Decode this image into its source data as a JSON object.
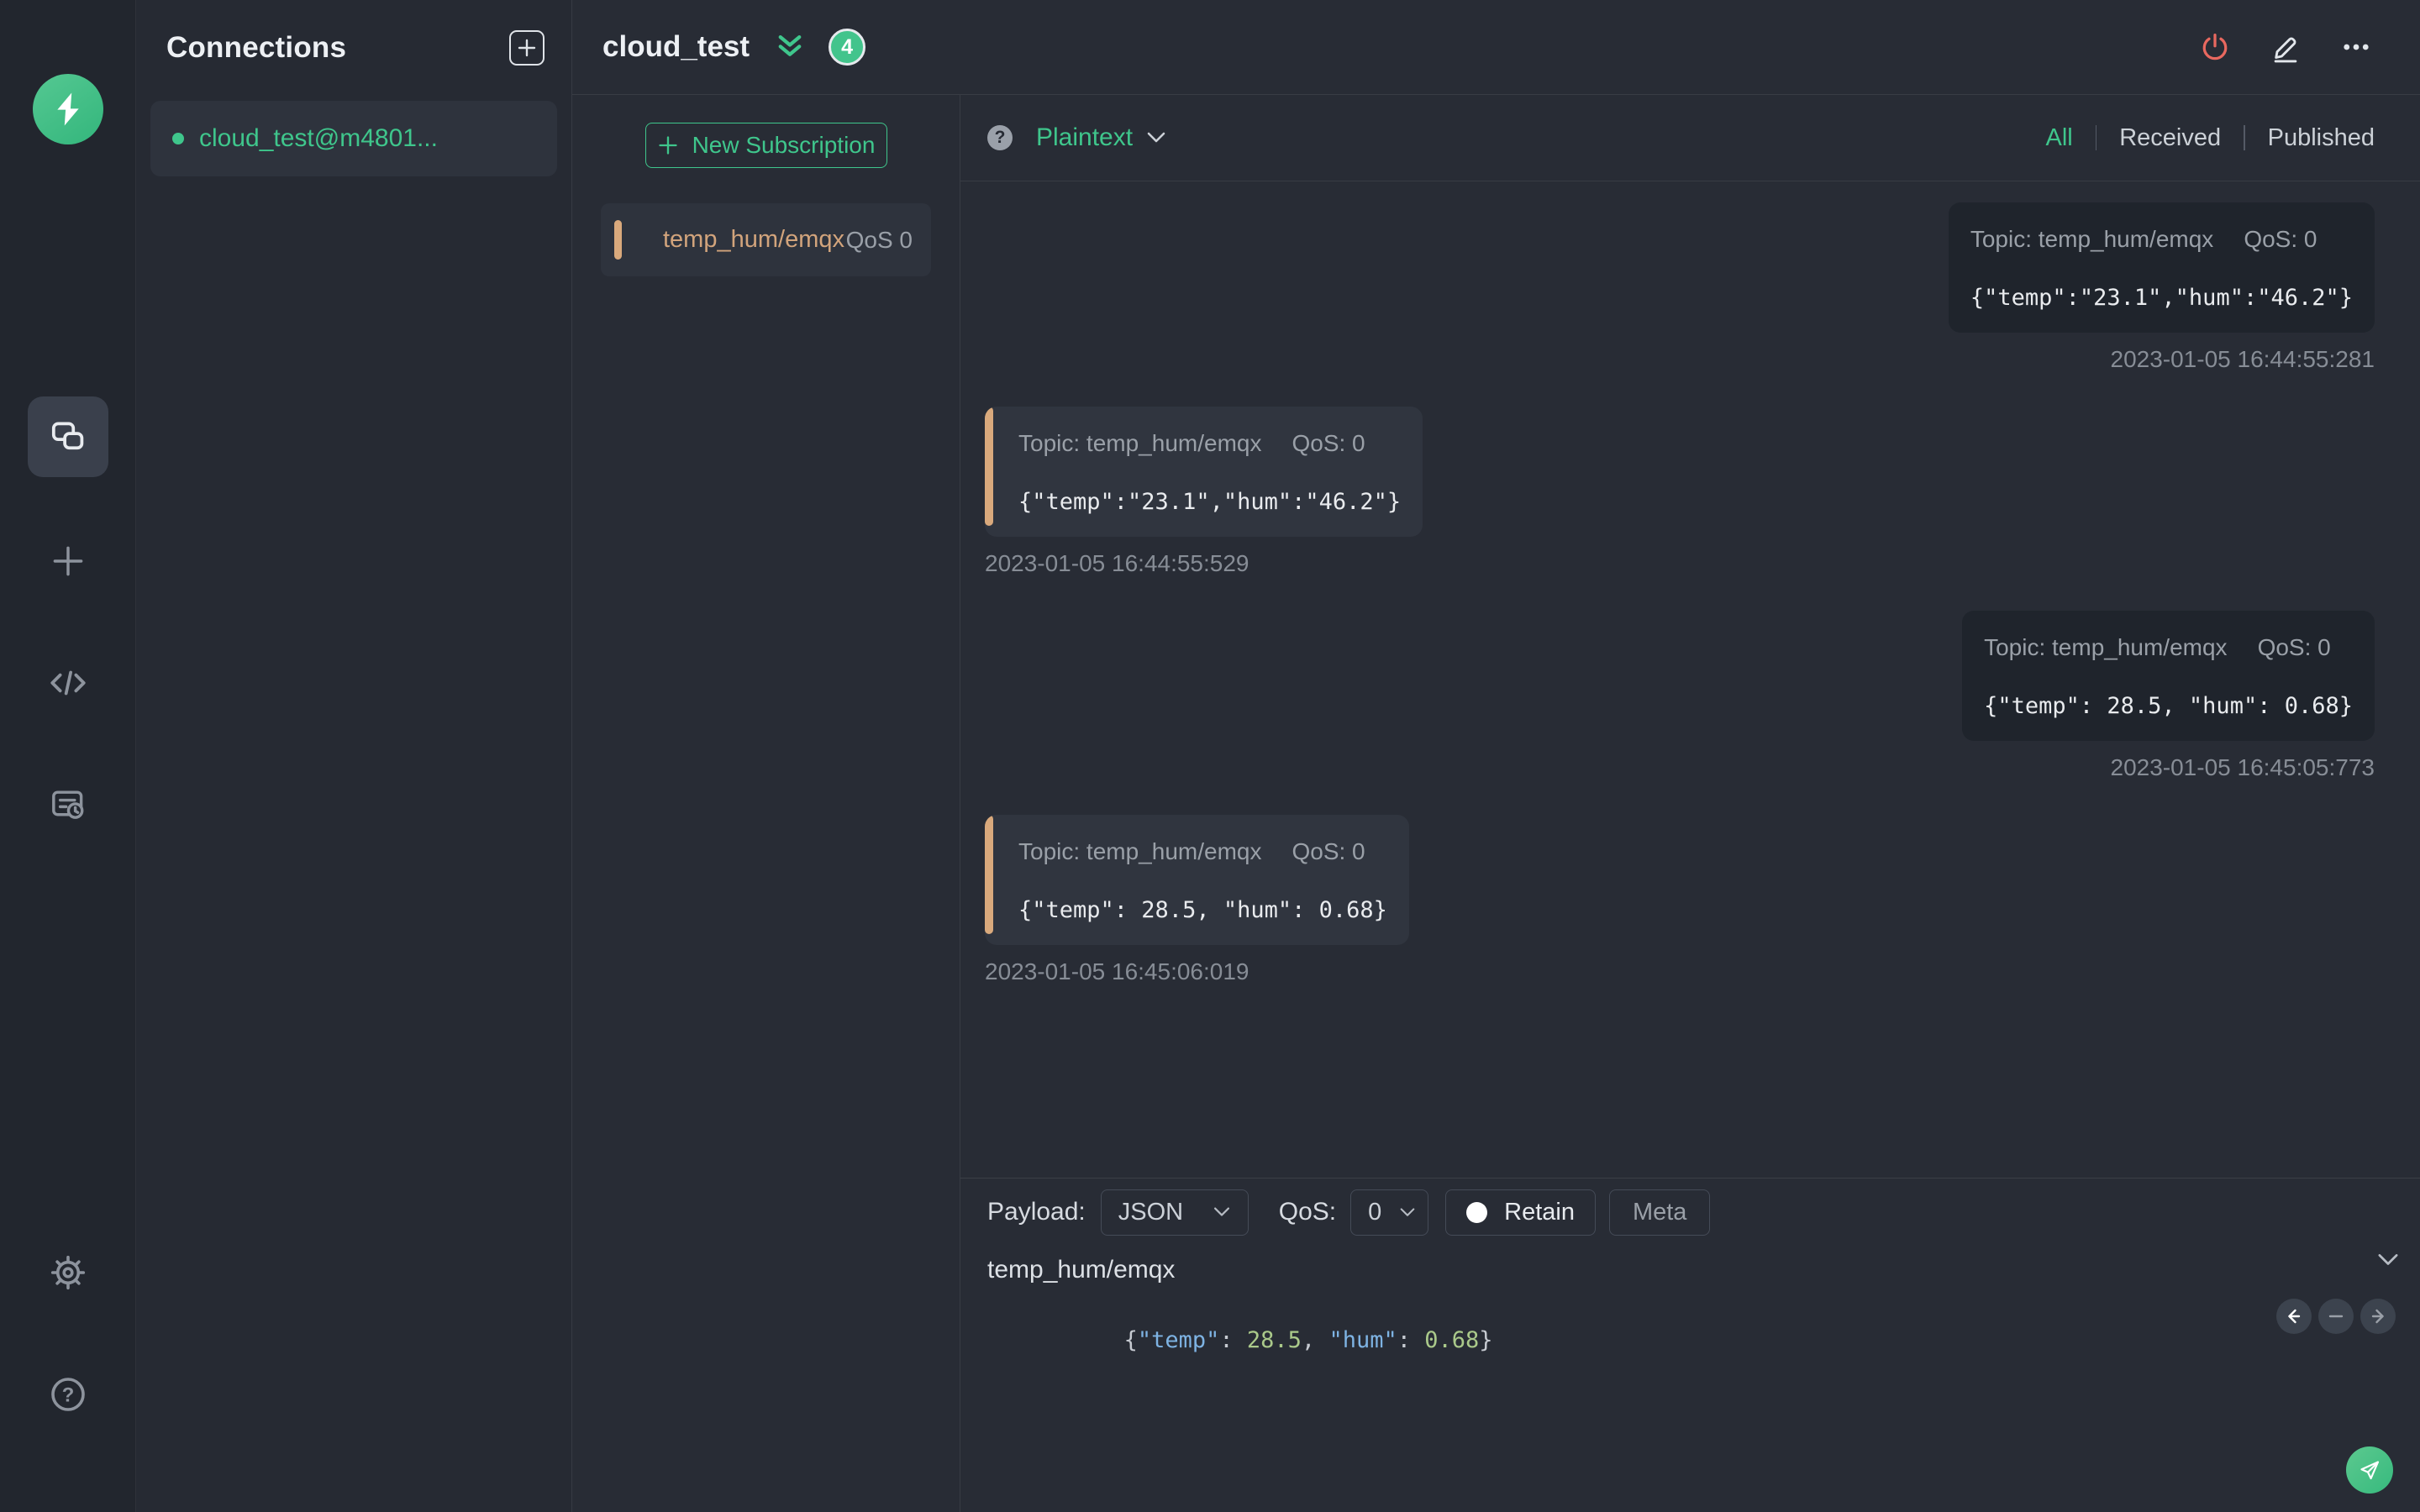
{
  "colors": {
    "accent_green": "#34c388",
    "green_text": "#3fc68c",
    "power_red": "#e8685f",
    "topic_tan": "#d2a47c",
    "bar_tan": "#d9a97c",
    "received_bubble": "#30353f",
    "published_bubble": "#1f242c",
    "editor_key_blue": "#7eb3e3",
    "editor_number_green": "#aac98a",
    "editor_punct_gray": "#c6cad1"
  },
  "connections_panel": {
    "title": "Connections",
    "items": [
      {
        "label": "cloud_test@m4801..."
      }
    ]
  },
  "header": {
    "title": "cloud_test",
    "badge_count": "4"
  },
  "subscriptions": {
    "new_subscription_label": "New Subscription",
    "items": [
      {
        "topic": "temp_hum/emqx",
        "qos": "QoS 0"
      }
    ]
  },
  "messages_toolbar": {
    "format": "Plaintext",
    "help_glyph": "?",
    "filters": [
      "All",
      "Received",
      "Published"
    ],
    "active_filter": "All"
  },
  "messages": {
    "items": [
      {
        "direction": "published",
        "topic_label": "Topic: temp_hum/emqx",
        "qos_label": "QoS: 0",
        "payload": "{\"temp\":\"23.1\",\"hum\":\"46.2\"}",
        "timestamp": "2023-01-05 16:44:55:281"
      },
      {
        "direction": "received",
        "topic_label": "Topic: temp_hum/emqx",
        "qos_label": "QoS: 0",
        "payload": "{\"temp\":\"23.1\",\"hum\":\"46.2\"}",
        "timestamp": "2023-01-05 16:44:55:529"
      },
      {
        "direction": "published",
        "topic_label": "Topic: temp_hum/emqx",
        "qos_label": "QoS: 0",
        "payload": "{\"temp\": 28.5, \"hum\": 0.68}",
        "timestamp": "2023-01-05 16:45:05:773"
      },
      {
        "direction": "received",
        "topic_label": "Topic: temp_hum/emqx",
        "qos_label": "QoS: 0",
        "payload": "{\"temp\": 28.5, \"hum\": 0.68}",
        "timestamp": "2023-01-05 16:45:06:019"
      }
    ]
  },
  "publish": {
    "payload_label": "Payload:",
    "format_value": "JSON",
    "qos_label": "QoS:",
    "qos_value": "0",
    "retain_label": "Retain",
    "meta_label": "Meta",
    "topic_value": "temp_hum/emqx",
    "payload_tokens": [
      {
        "text": "{",
        "color": "#c6cad1"
      },
      {
        "text": "\"temp\"",
        "color": "#7eb3e3"
      },
      {
        "text": ": ",
        "color": "#c6cad1"
      },
      {
        "text": "28.5",
        "color": "#aac98a"
      },
      {
        "text": ", ",
        "color": "#c6cad1"
      },
      {
        "text": "\"hum\"",
        "color": "#7eb3e3"
      },
      {
        "text": ": ",
        "color": "#c6cad1"
      },
      {
        "text": "0.68",
        "color": "#aac98a"
      },
      {
        "text": "}",
        "color": "#c6cad1"
      }
    ]
  }
}
